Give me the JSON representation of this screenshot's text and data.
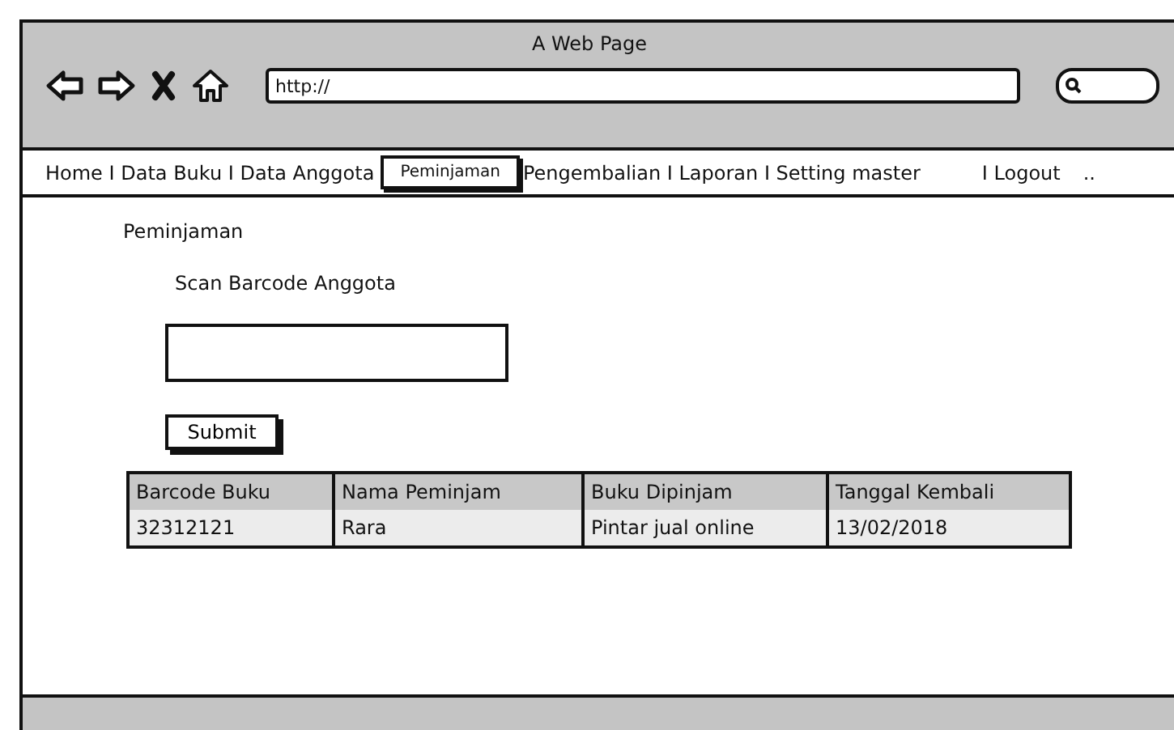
{
  "window": {
    "title": "A Web Page"
  },
  "address_bar": {
    "value": "http://"
  },
  "nav": [
    {
      "label": "Home I Data Buku I Data Anggota",
      "selected": false
    },
    {
      "label": "Peminjaman",
      "selected": true
    },
    {
      "label": "Pengembalian I Laporan I Setting master",
      "selected": false
    },
    {
      "label": "I Logout",
      "selected": false
    },
    {
      "label": "..",
      "selected": false
    }
  ],
  "page": {
    "heading": "Peminjaman",
    "field_label": "Scan Barcode Anggota",
    "submit": "Submit"
  },
  "table": {
    "columns": [
      "Barcode Buku",
      "Nama Peminjam",
      "Buku Dipinjam",
      "Tanggal Kembali"
    ],
    "rows": [
      [
        "32312121",
        "Rara",
        "Pintar jual online",
        "13/02/2018"
      ]
    ]
  }
}
